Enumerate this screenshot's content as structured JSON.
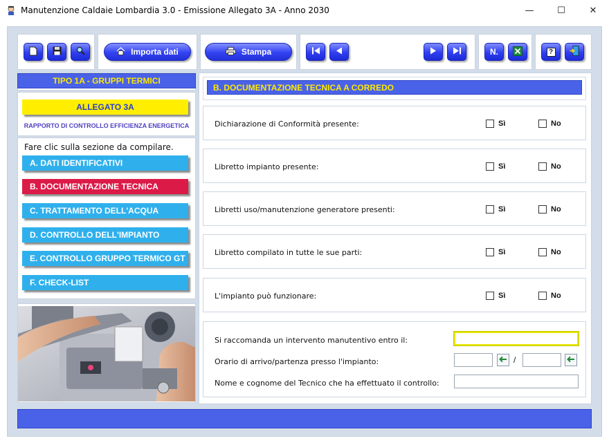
{
  "window": {
    "title": "Manutenzione Caldaie Lombardia 3.0 - Emissione Allegato 3A - Anno 2030",
    "minimize": "—",
    "maximize": "☐",
    "close": "✕"
  },
  "toolbar": {
    "importa_label": "Importa dati",
    "stampa_label": "Stampa",
    "numero_label": "N.",
    "help_label": "?",
    "icons": [
      "new-document-icon",
      "save-icon",
      "search-icon",
      "home-icon",
      "printer-icon",
      "first-record-icon",
      "previous-record-icon",
      "next-record-icon",
      "last-record-icon",
      "excel-icon",
      "help-icon",
      "exit-icon"
    ]
  },
  "sidebar": {
    "section_title": "TIPO 1A - GRUPPI TERMICI",
    "allegato": "ALLEGATO 3A",
    "rapporto": "RAPPORTO DI CONTROLLO EFFICIENZA ENERGETICA",
    "hint": "Fare clic sulla sezione da compilare.",
    "items": [
      {
        "label": "A. DATI IDENTIFICATIVI",
        "active": false
      },
      {
        "label": "B. DOCUMENTAZIONE TECNICA",
        "active": true
      },
      {
        "label": "C. TRATTAMENTO DELL'ACQUA",
        "active": false
      },
      {
        "label": "D. CONTROLLO DELL'IMPIANTO",
        "active": false
      },
      {
        "label": "E. CONTROLLO GRUPPO TERMICO GT",
        "active": false
      },
      {
        "label": "F. CHECK-LIST",
        "active": false
      }
    ]
  },
  "main": {
    "section_header": "B. DOCUMENTAZIONE TECNICA A CORREDO",
    "yes_label": "Sì",
    "no_label": "No",
    "questions": [
      {
        "label": "Dichiarazione di Conformità presente:",
        "yes": false,
        "no": false
      },
      {
        "label": "Libretto impianto presente:",
        "yes": false,
        "no": false
      },
      {
        "label": "Libretti uso/manutenzione generatore presenti:",
        "yes": false,
        "no": false
      },
      {
        "label": "Libretto compilato in tutte le sue parti:",
        "yes": false,
        "no": false
      },
      {
        "label": "L'impianto può funzionare:",
        "yes": false,
        "no": false
      }
    ],
    "intervento_label": "Si raccomanda un intervento manutentivo entro il:",
    "intervento_value": "",
    "orario_label": "Orario di arrivo/partenza presso l'impianto:",
    "orario_arrivo": "",
    "orario_partenza": "",
    "orario_separator": "/",
    "tecnico_label": "Nome e cognome del Tecnico che ha effettuato il controllo:",
    "tecnico_value": ""
  },
  "colors": {
    "accent_blue": "#4a62e8",
    "header_yellow": "#ffea00",
    "nav_cyan": "#2fb0ec",
    "nav_active": "#dc1a48",
    "focus_yellow": "#e7e600"
  }
}
